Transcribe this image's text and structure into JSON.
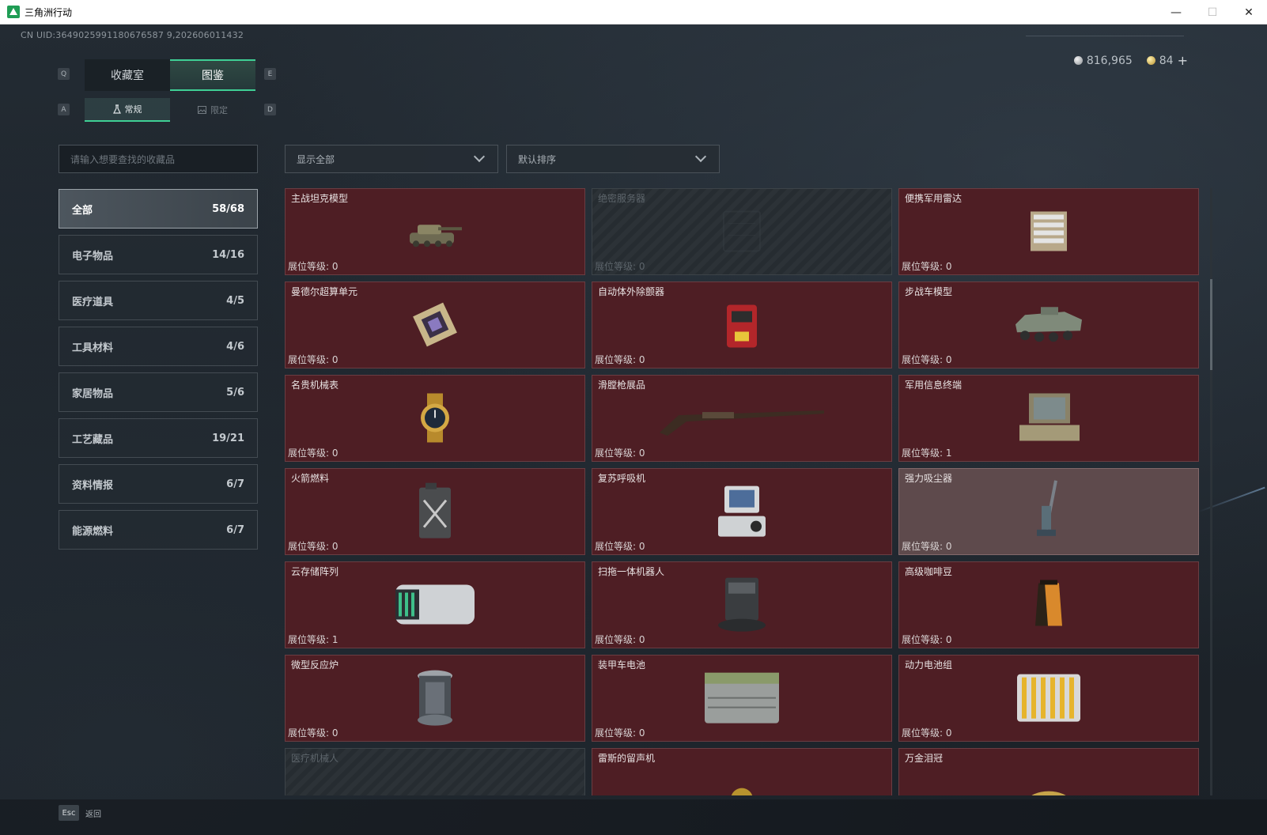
{
  "window": {
    "title": "三角洲行动",
    "minimize": "—",
    "maximize": "☐",
    "close": "✕"
  },
  "uid": "CN UID:3649025991180676587 9,202606011432",
  "currency": {
    "silver": "816,965",
    "gold": "84",
    "add": "+"
  },
  "keys": {
    "q": "Q",
    "e": "E",
    "a": "A",
    "d": "D",
    "esc": "Esc"
  },
  "tabs": [
    {
      "label": "收藏室"
    },
    {
      "label": "图鉴"
    }
  ],
  "subtabs": [
    {
      "label": "常规"
    },
    {
      "label": "限定"
    }
  ],
  "search": {
    "placeholder": "请输入想要查找的收藏品"
  },
  "filters": {
    "show": "显示全部",
    "sort": "默认排序"
  },
  "categories": [
    {
      "name": "全部",
      "count": "58/68"
    },
    {
      "name": "电子物品",
      "count": "14/16"
    },
    {
      "name": "医疗道具",
      "count": "4/5"
    },
    {
      "name": "工具材料",
      "count": "4/6"
    },
    {
      "name": "家居物品",
      "count": "5/6"
    },
    {
      "name": "工艺藏品",
      "count": "19/21"
    },
    {
      "name": "资料情报",
      "count": "6/7"
    },
    {
      "name": "能源燃料",
      "count": "6/7"
    }
  ],
  "level_label": "展位等级: ",
  "items": [
    {
      "name": "主战坦克模型",
      "level": "0",
      "icon": "tank-icon"
    },
    {
      "name": "绝密服务器",
      "level": "0",
      "icon": "server-icon",
      "locked": true
    },
    {
      "name": "便携军用雷达",
      "level": "0",
      "icon": "radar-icon"
    },
    {
      "name": "曼德尔超算单元",
      "level": "0",
      "icon": "chip-icon"
    },
    {
      "name": "自动体外除颤器",
      "level": "0",
      "icon": "defibrillator-icon"
    },
    {
      "name": "步战车模型",
      "level": "0",
      "icon": "apc-icon"
    },
    {
      "name": "名贵机械表",
      "level": "0",
      "icon": "watch-icon"
    },
    {
      "name": "滑膛枪展品",
      "level": "0",
      "icon": "musket-icon"
    },
    {
      "name": "军用信息终端",
      "level": "1",
      "icon": "terminal-icon"
    },
    {
      "name": "火箭燃料",
      "level": "0",
      "icon": "fuel-can-icon"
    },
    {
      "name": "复苏呼吸机",
      "level": "0",
      "icon": "ventilator-icon"
    },
    {
      "name": "强力吸尘器",
      "level": "0",
      "icon": "vacuum-icon",
      "hover": true
    },
    {
      "name": "云存储阵列",
      "level": "1",
      "icon": "storage-array-icon"
    },
    {
      "name": "扫拖一体机器人",
      "level": "0",
      "icon": "robot-vacuum-icon"
    },
    {
      "name": "高级咖啡豆",
      "level": "0",
      "icon": "coffee-bag-icon"
    },
    {
      "name": "微型反应炉",
      "level": "0",
      "icon": "reactor-icon"
    },
    {
      "name": "装甲车电池",
      "level": "0",
      "icon": "battery-icon"
    },
    {
      "name": "动力电池组",
      "level": "0",
      "icon": "battery-pack-icon"
    },
    {
      "name": "医疗机械人",
      "level": "",
      "icon": "med-robot-icon",
      "locked": true
    },
    {
      "name": "雷斯的留声机",
      "level": "",
      "icon": "gramophone-icon"
    },
    {
      "name": "万金泪冠",
      "level": "",
      "icon": "crown-icon"
    }
  ],
  "footer": {
    "back": "返回"
  }
}
